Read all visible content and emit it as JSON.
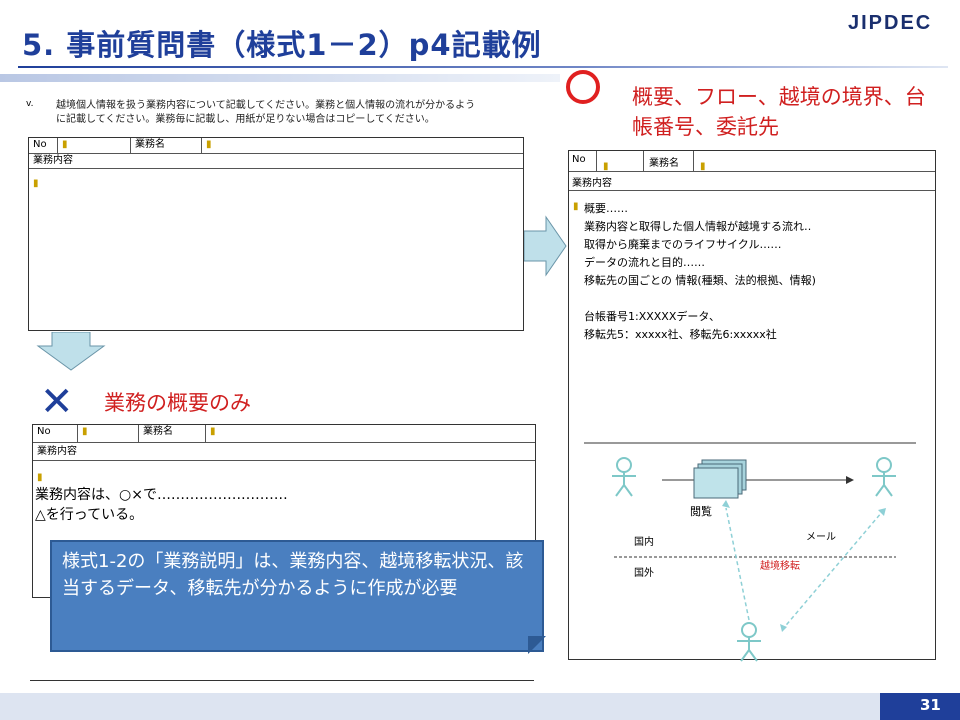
{
  "header": {
    "title": "5. 事前質問書（様式1－2）p4記載例",
    "logo": "JIPDEC",
    "page_number": "31"
  },
  "instruction": {
    "marker": "v.",
    "line1": "越境個人情報を扱う業務内容について記載してください。業務と個人情報の流れが分かるよう",
    "line2": "に記載してください。業務毎に記載し、用紙が足りない場合はコピーしてください。"
  },
  "form": {
    "no_label": "No",
    "name_label": "業務名",
    "content_label": "業務内容"
  },
  "good_example": {
    "heading": "概要、フロー、越境の境界、台帳番号、委託先",
    "details": [
      "概要‥‥‥",
      "業務内容と取得した個人情報が越境する流れ‥",
      "取得から廃棄までのライフサイクル‥‥‥",
      "データの流れと目的‥‥‥",
      "移転先の国ごとの 情報(種類、法的根拠、情報)",
      "",
      "台帳番号1:XXXXXデータ、",
      "移転先5：xxxxx社、移転先6:xxxxx社"
    ],
    "diagram": {
      "view_label": "閲覧",
      "mail_label": "メール",
      "domestic_label": "国内",
      "foreign_label": "国外",
      "border_label": "越境移転"
    }
  },
  "bad_example": {
    "heading": "業務の概要のみ",
    "content_line1": "業務内容は、○×で‥‥‥‥‥‥‥‥‥‥‥‥‥‥",
    "content_line2": "△を行っている。"
  },
  "callout": {
    "text": "様式1-2の「業務説明」は、業務内容、越境移転状況、該当するデータ、移転先が分かるように作成が必要"
  },
  "colors": {
    "title_blue": "#1f3f9a",
    "accent_red": "#d02020",
    "callout_blue": "#4a7fc0",
    "arrow_fill": "#bfe0ea"
  }
}
